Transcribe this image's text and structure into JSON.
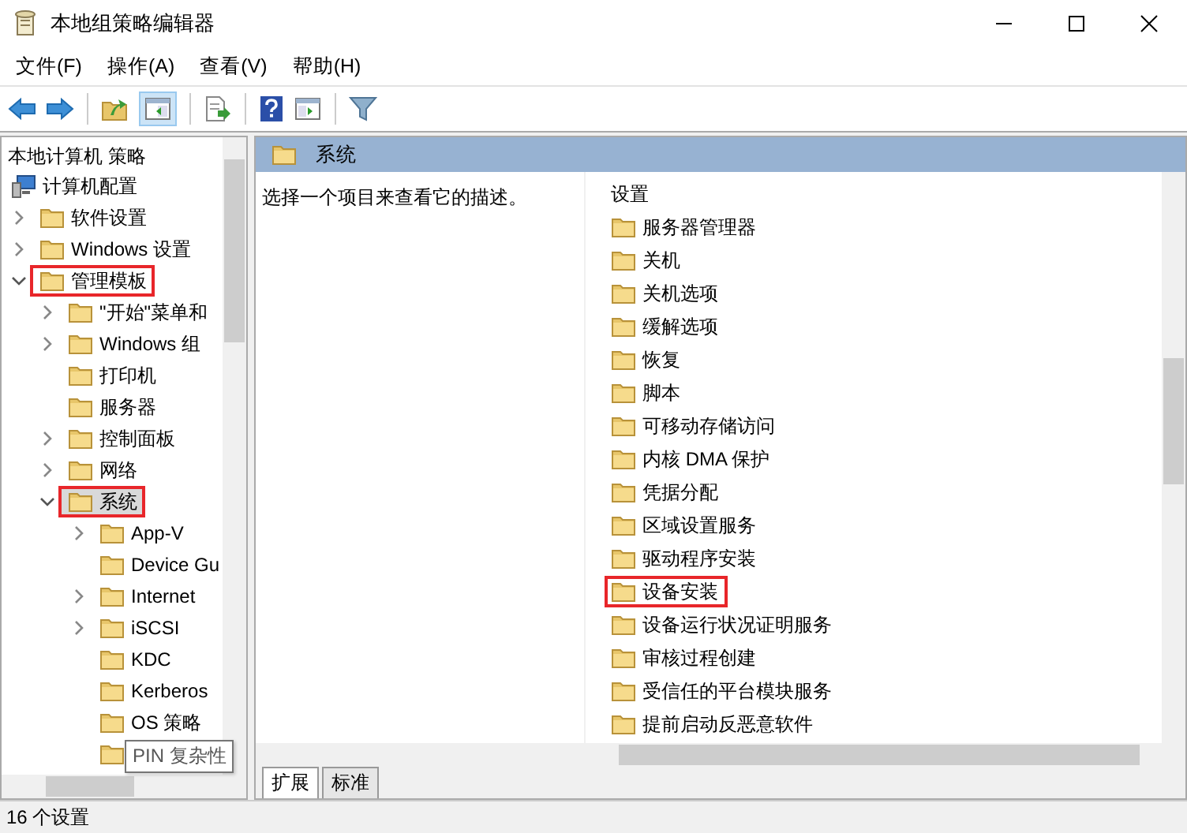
{
  "window": {
    "title": "本地组策略编辑器"
  },
  "menu": [
    "文件(F)",
    "操作(A)",
    "查看(V)",
    "帮助(H)"
  ],
  "toolbar": {
    "tree_toggle_pressed": true
  },
  "tree": {
    "root": "本地计算机 策略",
    "children": [
      {
        "label": "计算机配置",
        "kind": "computer",
        "selected": false,
        "highlighted": false,
        "children": [
          {
            "label": "软件设置",
            "kind": "folder",
            "expandable": true,
            "expanded": false,
            "selected": false,
            "highlighted": false
          },
          {
            "label": "Windows 设置",
            "kind": "folder",
            "expandable": true,
            "expanded": false,
            "selected": false,
            "highlighted": false
          },
          {
            "label": "管理模板",
            "kind": "folder",
            "expandable": true,
            "expanded": true,
            "selected": false,
            "highlighted": true,
            "children": [
              {
                "label": "\"开始\"菜单和",
                "kind": "folder",
                "expandable": true,
                "expanded": false,
                "selected": false,
                "highlighted": false
              },
              {
                "label": "Windows 组",
                "kind": "folder",
                "expandable": true,
                "expanded": false,
                "selected": false,
                "highlighted": false
              },
              {
                "label": "打印机",
                "kind": "folder",
                "selected": false,
                "highlighted": false
              },
              {
                "label": "服务器",
                "kind": "folder",
                "selected": false,
                "highlighted": false
              },
              {
                "label": "控制面板",
                "kind": "folder",
                "expandable": true,
                "expanded": false,
                "selected": false,
                "highlighted": false
              },
              {
                "label": "网络",
                "kind": "folder",
                "expandable": true,
                "expanded": false,
                "selected": false,
                "highlighted": false
              },
              {
                "label": "系统",
                "kind": "folder",
                "expandable": true,
                "expanded": true,
                "selected": true,
                "highlighted": true,
                "children": [
                  {
                    "label": "App-V",
                    "kind": "folder",
                    "expandable": true,
                    "expanded": false,
                    "selected": false,
                    "highlighted": false
                  },
                  {
                    "label": "Device Gu",
                    "kind": "folder",
                    "selected": false,
                    "highlighted": false
                  },
                  {
                    "label": "Internet",
                    "kind": "folder",
                    "expandable": true,
                    "expanded": false,
                    "selected": false,
                    "highlighted": false
                  },
                  {
                    "label": "iSCSI",
                    "kind": "folder",
                    "expandable": true,
                    "expanded": false,
                    "selected": false,
                    "highlighted": false
                  },
                  {
                    "label": "KDC",
                    "kind": "folder",
                    "selected": false,
                    "highlighted": false
                  },
                  {
                    "label": "Kerberos",
                    "kind": "folder",
                    "selected": false,
                    "highlighted": false
                  },
                  {
                    "label": "OS 策略",
                    "kind": "folder",
                    "selected": false,
                    "highlighted": false
                  },
                  {
                    "tooltip": "PIN 复杂性",
                    "kind": "folder",
                    "selected": false,
                    "highlighted": false
                  }
                ]
              }
            ]
          }
        ]
      }
    ]
  },
  "detail": {
    "title": "系统",
    "description": "选择一个项目来查看它的描述。",
    "column": "设置",
    "items": [
      {
        "label": "服务器管理器",
        "highlighted": false
      },
      {
        "label": "关机",
        "highlighted": false
      },
      {
        "label": "关机选项",
        "highlighted": false
      },
      {
        "label": "缓解选项",
        "highlighted": false
      },
      {
        "label": "恢复",
        "highlighted": false
      },
      {
        "label": "脚本",
        "highlighted": false
      },
      {
        "label": "可移动存储访问",
        "highlighted": false
      },
      {
        "label": "内核 DMA 保护",
        "highlighted": false
      },
      {
        "label": "凭据分配",
        "highlighted": false
      },
      {
        "label": "区域设置服务",
        "highlighted": false
      },
      {
        "label": "驱动程序安装",
        "highlighted": false
      },
      {
        "label": "设备安装",
        "highlighted": true
      },
      {
        "label": "设备运行状况证明服务",
        "highlighted": false
      },
      {
        "label": "审核过程创建",
        "highlighted": false
      },
      {
        "label": "受信任的平台模块服务",
        "highlighted": false
      },
      {
        "label": "提前启动反恶意软件",
        "highlighted": false
      }
    ],
    "tabs": [
      {
        "label": "扩展",
        "selected": true
      },
      {
        "label": "标准",
        "selected": false
      }
    ]
  },
  "status_bar": "16 个设置"
}
